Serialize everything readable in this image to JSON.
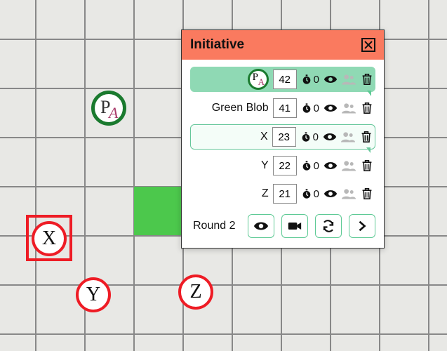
{
  "panel": {
    "title": "Initiative",
    "rows": [
      {
        "name": "",
        "value": "42",
        "timer": "0",
        "is_active": true,
        "has_avatar": true,
        "visible": true
      },
      {
        "name": "Green Blob",
        "value": "41",
        "timer": "0",
        "is_active": false,
        "has_avatar": false,
        "visible": true
      },
      {
        "name": "X",
        "value": "23",
        "timer": "0",
        "is_active": false,
        "has_avatar": false,
        "outlined": true,
        "visible": true
      },
      {
        "name": "Y",
        "value": "22",
        "timer": "0",
        "is_active": false,
        "has_avatar": false,
        "visible": true
      },
      {
        "name": "Z",
        "value": "21",
        "timer": "0",
        "is_active": false,
        "has_avatar": false,
        "visible": true
      }
    ],
    "round_label": "Round 2"
  },
  "tokens": {
    "pa": "PA",
    "x": "X",
    "y": "Y",
    "z": "Z"
  }
}
